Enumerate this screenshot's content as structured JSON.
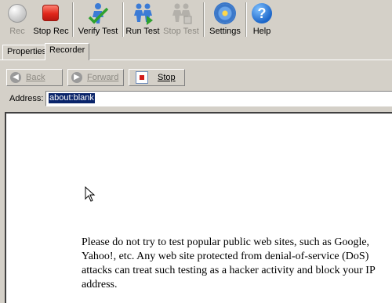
{
  "toolbar": {
    "rec": "Rec",
    "stop_rec": "Stop Rec",
    "verify_test": "Verify Test",
    "run_test": "Run Test",
    "stop_test": "Stop Test",
    "settings": "Settings",
    "help": "Help"
  },
  "tabs": [
    {
      "label": "Properties"
    },
    {
      "label": "Recorder"
    }
  ],
  "navigation": {
    "back": "Back",
    "forward": "Forward",
    "stop": "Stop"
  },
  "address": {
    "label": "Address:",
    "value": "about:blank"
  },
  "content": {
    "notice": "Please do not try to test popular public web sites, such as Google, Yahoo!, etc. Any web site protected from denial-of-service (DoS) attacks can treat such testing as a hacker activity and block your IP address."
  },
  "colors": {
    "window_bg": "#d4d0c8",
    "selection": "#0a246a",
    "stop_red": "#e0271b"
  }
}
